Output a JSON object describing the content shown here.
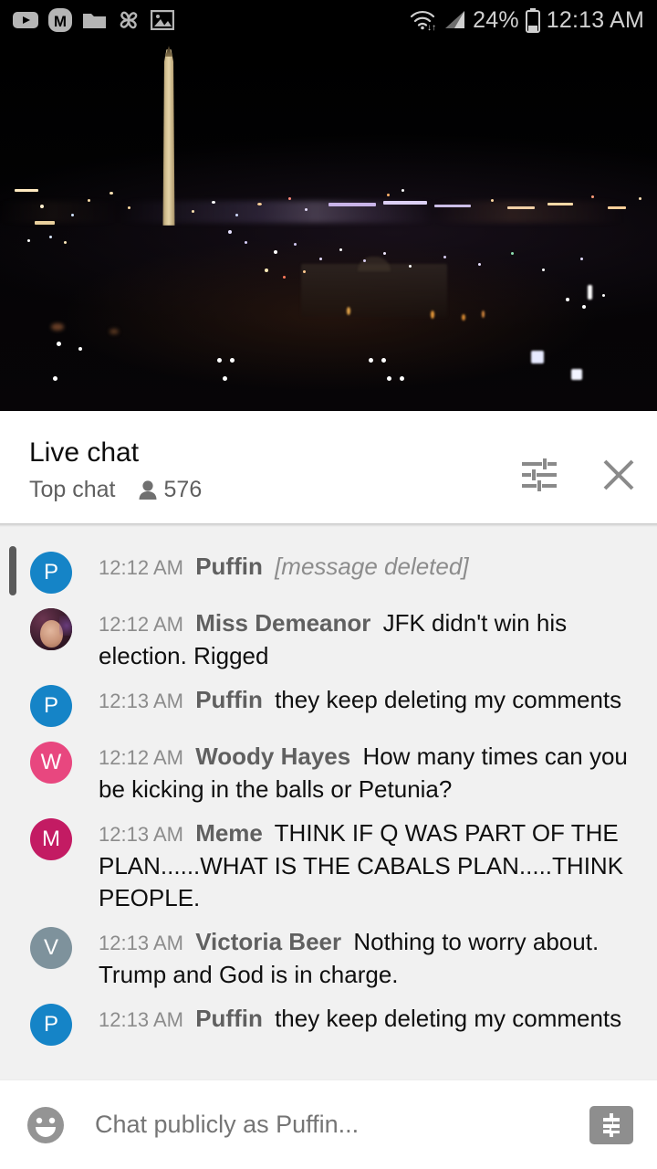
{
  "status_bar": {
    "time": "12:13 AM",
    "battery_percent": "24%",
    "icons": [
      "youtube-icon",
      "m-app-icon",
      "folder-icon",
      "pinwheel-icon",
      "image-icon",
      "wifi-icon",
      "cellular-signal-icon",
      "battery-icon"
    ]
  },
  "video": {
    "description": "Washington DC night skyline live stream",
    "progress_bar_color": "#e8090b"
  },
  "chat_header": {
    "title": "Live chat",
    "mode": "Top chat",
    "viewer_count": "576",
    "tune_icon": "tune-icon",
    "close_icon": "close-icon"
  },
  "clipped_message_above": "…",
  "messages": [
    {
      "time": "12:12 AM",
      "author": "Puffin",
      "text": "[message deleted]",
      "deleted": true,
      "avatar": {
        "type": "letter",
        "letter": "P",
        "color": "#1584c7"
      }
    },
    {
      "time": "12:12 AM",
      "author": "Miss Demeanor",
      "text": "JFK didn't win his election. Rigged",
      "deleted": false,
      "avatar": {
        "type": "photo",
        "letter": "",
        "color": "#4a2b3a"
      }
    },
    {
      "time": "12:13 AM",
      "author": "Puffin",
      "text": "they keep deleting my comments",
      "deleted": false,
      "avatar": {
        "type": "letter",
        "letter": "P",
        "color": "#1584c7"
      }
    },
    {
      "time": "12:12 AM",
      "author": "Woody Hayes",
      "text": "How many times can you be kicking in the balls or Petunia?",
      "deleted": false,
      "avatar": {
        "type": "letter",
        "letter": "W",
        "color": "#e8477f"
      }
    },
    {
      "time": "12:13 AM",
      "author": "Meme",
      "text": "THINK IF Q WAS PART OF THE PLAN......WHAT IS THE CABALS PLAN.....THINK PEOPLE.",
      "deleted": false,
      "avatar": {
        "type": "letter",
        "letter": "M",
        "color": "#c31b63"
      }
    },
    {
      "time": "12:13 AM",
      "author": "Victoria Beer",
      "text": "Nothing to worry about. Trump and God is in charge.",
      "deleted": false,
      "avatar": {
        "type": "letter",
        "letter": "V",
        "color": "#7e929c"
      }
    },
    {
      "time": "12:13 AM",
      "author": "Puffin",
      "text": "they keep deleting my comments",
      "deleted": false,
      "avatar": {
        "type": "letter",
        "letter": "P",
        "color": "#1584c7"
      }
    }
  ],
  "input_bar": {
    "placeholder": "Chat publicly as Puffin...",
    "value": "",
    "emoji_icon": "emoji-smiley-icon",
    "superchat_icon": "dollar-sign-icon"
  }
}
